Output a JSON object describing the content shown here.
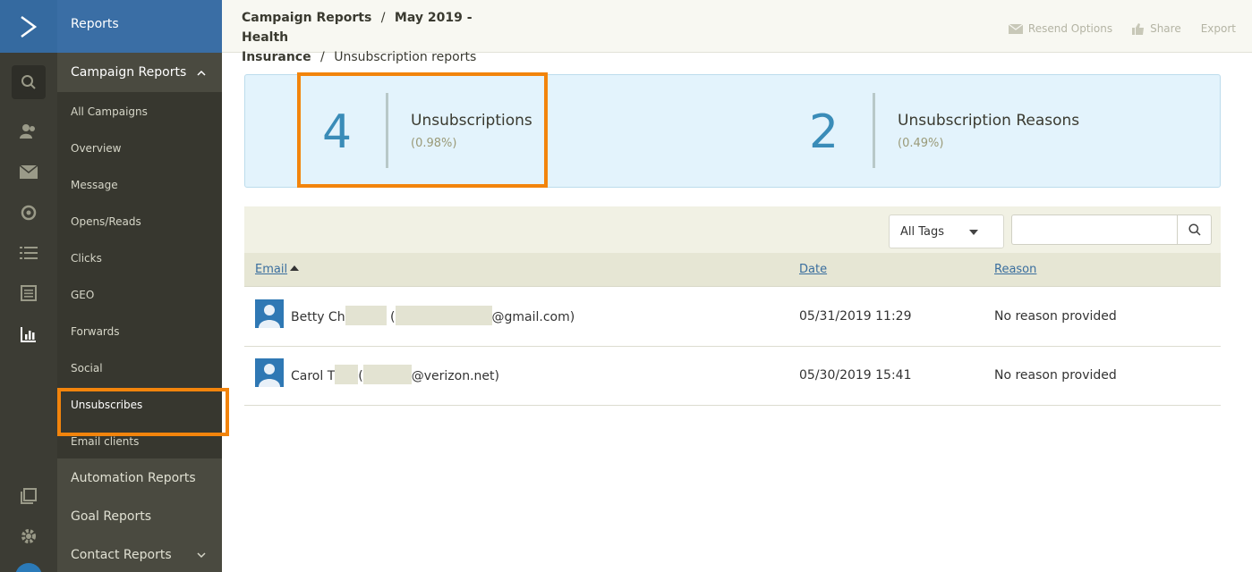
{
  "app": {
    "section_title": "Reports"
  },
  "menu": {
    "campaign_reports": "Campaign Reports",
    "items": [
      {
        "label": "All Campaigns"
      },
      {
        "label": "Overview"
      },
      {
        "label": "Message"
      },
      {
        "label": "Opens/Reads"
      },
      {
        "label": "Clicks"
      },
      {
        "label": "GEO"
      },
      {
        "label": "Forwards"
      },
      {
        "label": "Social"
      },
      {
        "label": "Unsubscribes",
        "active": true
      },
      {
        "label": "Email clients"
      }
    ],
    "automation_reports": "Automation Reports",
    "goal_reports": "Goal Reports",
    "contact_reports": "Contact Reports"
  },
  "rail_icons": [
    "logo-icon",
    "search-icon",
    "contacts-icon",
    "campaigns-icon",
    "automations-icon",
    "lists-icon",
    "forms-icon",
    "reports-icon",
    "apps-icon",
    "settings-icon"
  ],
  "breadcrumb": {
    "root": "Campaign Reports",
    "sep": "/",
    "campaign_line1": "May 2019 - Health",
    "campaign_line2": "Insurance",
    "current": "Unsubscription reports"
  },
  "actions": {
    "resend": "Resend Options",
    "share": "Share",
    "export": "Export"
  },
  "stats": {
    "unsubscriptions": {
      "value": "4",
      "label": "Unsubscriptions",
      "pct": "(0.98%)"
    },
    "reasons": {
      "value": "2",
      "label": "Unsubscription Reasons",
      "pct": "(0.49%)"
    }
  },
  "filters": {
    "tags_selected": "All Tags",
    "search_value": ""
  },
  "table": {
    "columns": {
      "email": "Email",
      "date": "Date",
      "reason": "Reason"
    },
    "rows": [
      {
        "name_prefix": "Betty Ch",
        "paren_open": "(",
        "email_suffix": "@gmail.com)",
        "date": "05/31/2019 11:29",
        "reason": "No reason provided"
      },
      {
        "name_prefix": "Carol T",
        "paren_open": "(",
        "email_suffix": "@verizon.net)",
        "date": "05/30/2019 15:41",
        "reason": "No reason provided"
      }
    ]
  },
  "colors": {
    "accent": "#f2840c",
    "nav_blue": "#3a6ea5",
    "stat_number": "#3a8cb8"
  }
}
